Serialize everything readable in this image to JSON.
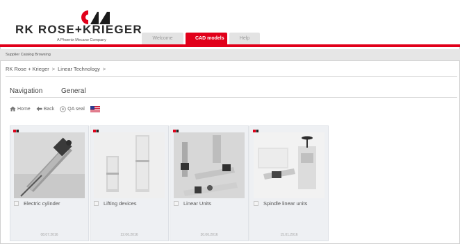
{
  "brand": {
    "name": "RK ROSE+KRIEGER",
    "tagline": "A Phoenix Mecano Company",
    "accent_color": "#e1001a"
  },
  "header_tabs": [
    {
      "label": "Welcome",
      "active": false
    },
    {
      "label": "CAD models",
      "active": true
    },
    {
      "label": "Help",
      "active": false
    }
  ],
  "supplier_bar": {
    "text": "Supplier Catalog Browsing"
  },
  "breadcrumb": {
    "items": [
      "RK Rose + Krieger",
      "Linear Technology"
    ],
    "separator": ">"
  },
  "section_tabs": [
    "Navigation",
    "General"
  ],
  "toolbar": {
    "home": "Home",
    "back": "Back",
    "qa_seal": "QA seal",
    "flag_icon": "us-flag-icon"
  },
  "cards": [
    {
      "title": "Electric cylinder",
      "date": "08.07.2016",
      "icon": "electric-cylinder-image"
    },
    {
      "title": "Lifting devices",
      "date": "22.06.2016",
      "icon": "lifting-devices-image"
    },
    {
      "title": "Linear Units",
      "date": "30.06.2016",
      "icon": "linear-units-image"
    },
    {
      "title": "Spindle linear units",
      "date": "15.01.2016",
      "icon": "spindle-linear-units-image"
    }
  ]
}
